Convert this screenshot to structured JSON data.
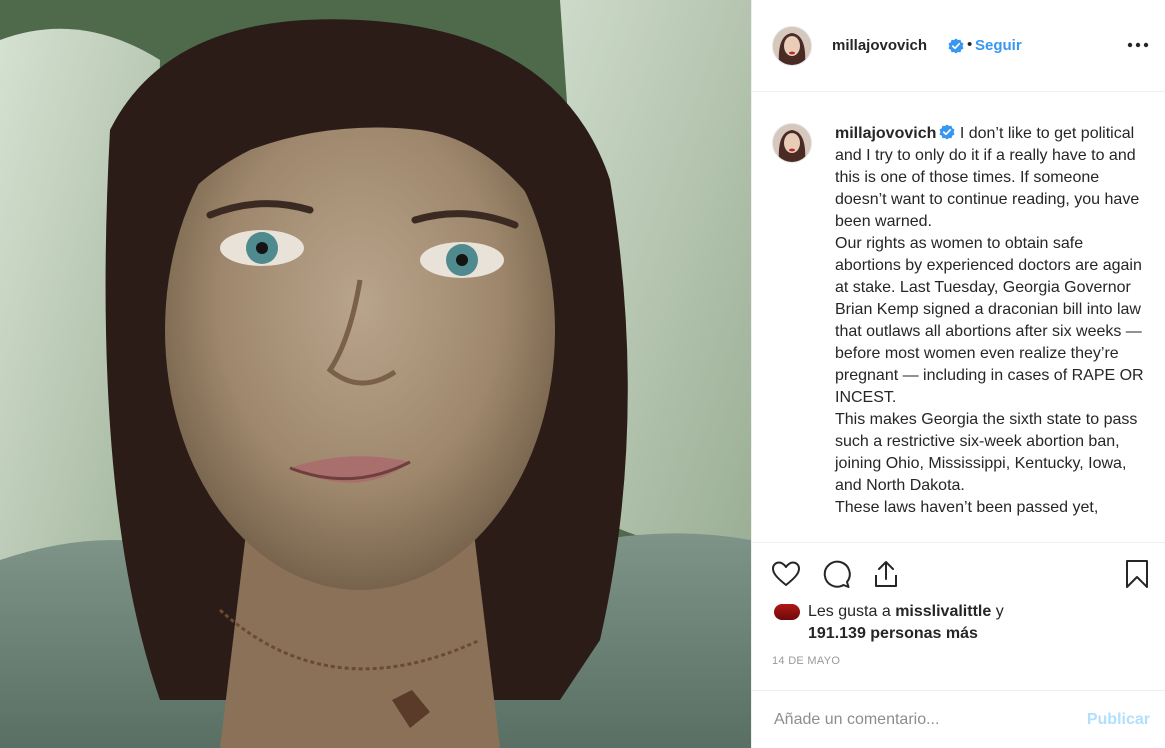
{
  "post": {
    "image_description_icon": "photo",
    "header": {
      "username": "millajovovich",
      "verified_icon": "verified-badge-icon",
      "separator": "•",
      "follow_label": "Seguir",
      "more_icon": "more-options-icon"
    },
    "caption": {
      "username": "millajovovich",
      "paragraphs": [
        "I don’t like to get political and I try to only do it if a really have to and this is one of those times. If someone doesn’t want to continue reading, you have been warned.",
        "Our rights as women to obtain safe abortions by experienced doctors are again at stake. Last Tuesday, Georgia Governor Brian Kemp signed a draconian bill into law that outlaws all abortions after six weeks — before most women even realize they’re pregnant — including in cases of RAPE OR INCEST.",
        "This makes Georgia the sixth state to pass such a restrictive six-week abortion ban, joining Ohio, Mississippi, Kentucky, Iowa, and North Dakota.",
        "These laws haven’t been passed yet,"
      ]
    },
    "actions": {
      "like_icon": "heart-icon",
      "comment_icon": "comment-icon",
      "share_icon": "share-icon",
      "save_icon": "bookmark-icon"
    },
    "likes": {
      "prefix": "Les gusta a",
      "liker": "misslivalittle",
      "conjunction": "y",
      "count_text": "191.139 personas más"
    },
    "date": "14 de mayo",
    "comment": {
      "placeholder": "Añade un comentario...",
      "publish_label": "Publicar"
    },
    "colors": {
      "link_blue": "#3897f0",
      "publish_disabled": "#b2dffc",
      "verified_blue": "#3897f0",
      "border": "#efefef",
      "text": "#262626",
      "muted": "#999999"
    }
  }
}
